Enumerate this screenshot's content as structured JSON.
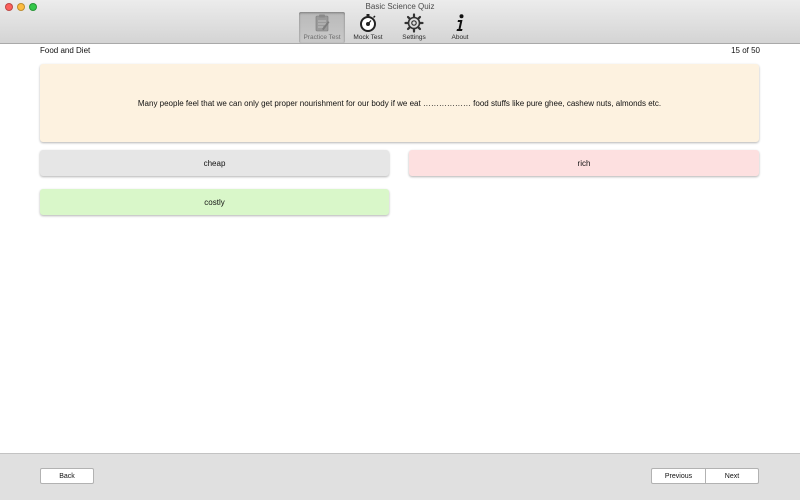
{
  "window": {
    "title": "Basic Science Quiz"
  },
  "toolbar": {
    "items": [
      {
        "label": "Practice Test",
        "icon": "clipboard-icon",
        "active": true
      },
      {
        "label": "Mock Test",
        "icon": "stopwatch-icon",
        "active": false
      },
      {
        "label": "Settings",
        "icon": "gear-icon",
        "active": false
      },
      {
        "label": "About",
        "icon": "info-icon",
        "active": false
      }
    ]
  },
  "quiz": {
    "section": "Food and Diet",
    "progress": "15 of 50",
    "question": "Many people feel that we can only get proper nourishment for our body if we eat ……………… food stuffs like pure ghee, cashew nuts, almonds etc.",
    "options": [
      {
        "label": "cheap",
        "state": "neutral",
        "color": "#e6e6e6"
      },
      {
        "label": "rich",
        "state": "incorrect",
        "color": "#fde0e0"
      },
      {
        "label": "costly",
        "state": "correct",
        "color": "#d9f7c9"
      }
    ]
  },
  "footer": {
    "back_label": "Back",
    "previous_label": "Previous",
    "next_label": "Next"
  }
}
